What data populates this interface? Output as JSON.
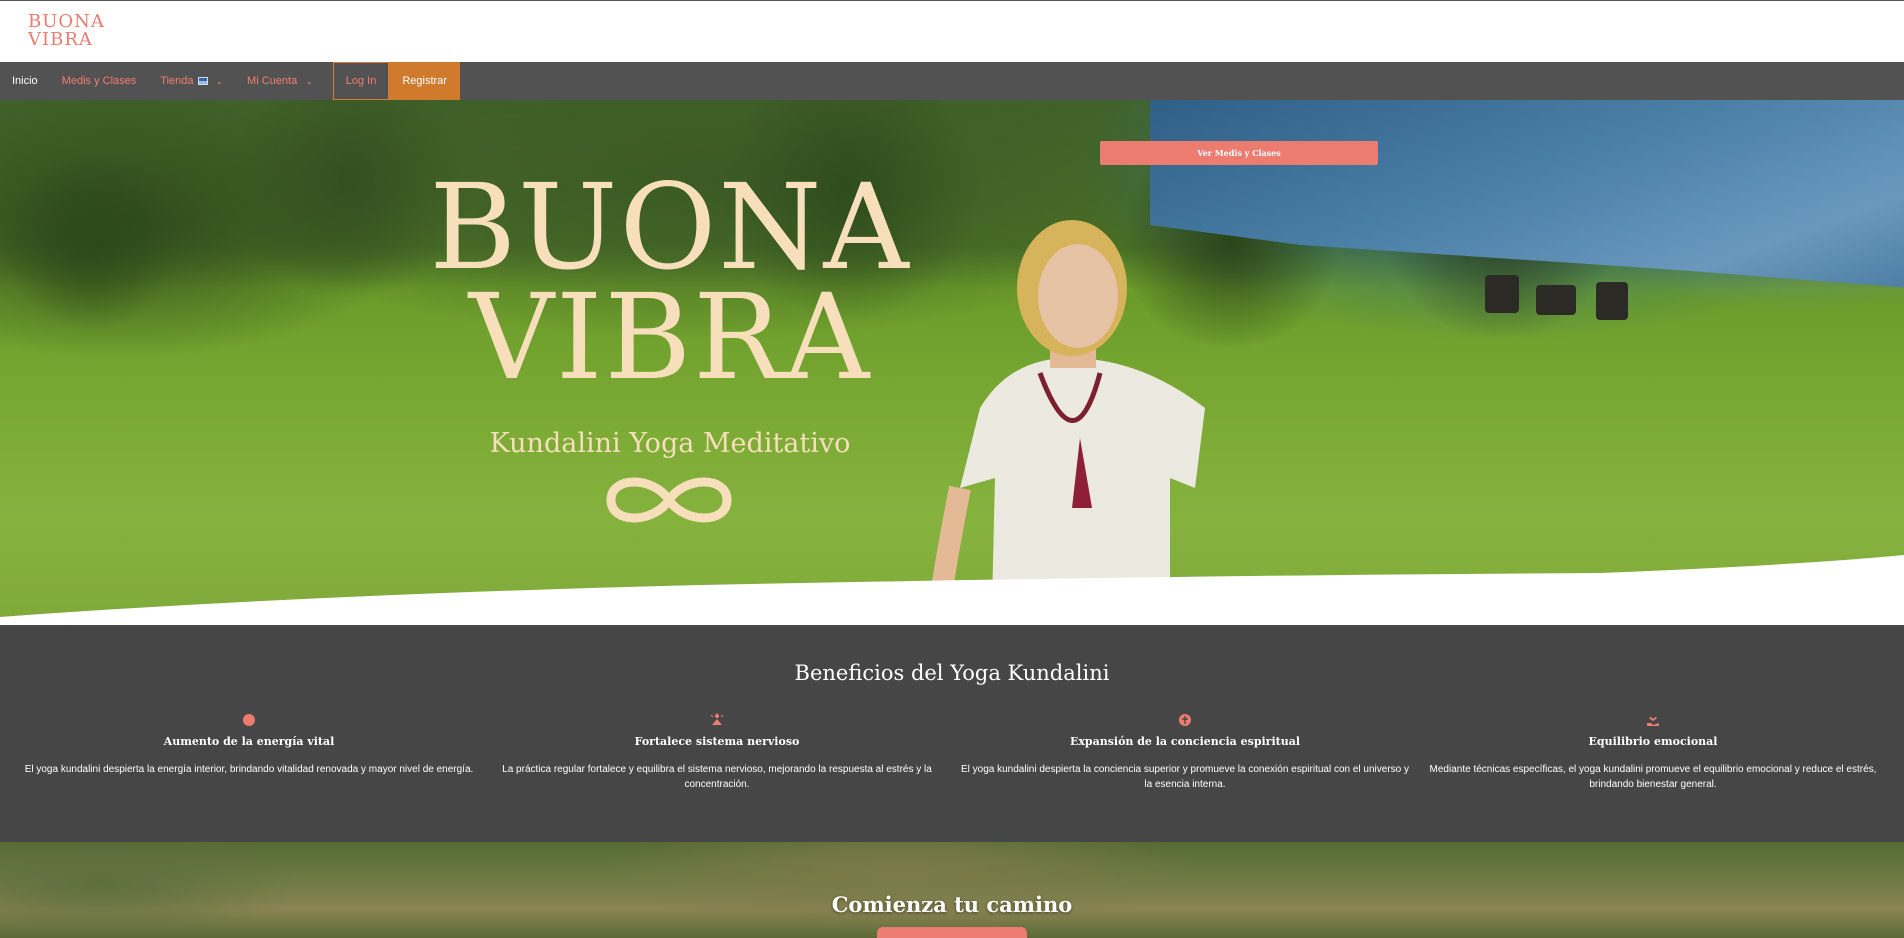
{
  "header": {
    "logo_line1": "BUONA",
    "logo_line2": "VIBRA"
  },
  "nav": {
    "items": [
      {
        "label": "Inicio"
      },
      {
        "label": "Medis y Clases"
      },
      {
        "label": "Tienda"
      },
      {
        "label": "Mi Cuenta"
      }
    ],
    "login_label": "Log In",
    "register_label": "Registrar"
  },
  "hero": {
    "title_line1": "BUONA",
    "title_line2": "VIBRA",
    "subtitle": "Kundalini Yoga Meditativo",
    "cta_label": "Ver Medis y Clases"
  },
  "benefits": {
    "title": "Beneficios del Yoga Kundalini",
    "items": [
      {
        "title": "Aumento de la energía vital",
        "text": "El yoga kundalini despierta la energía interior, brindando vitalidad renovada y mayor nivel de energía.",
        "icon": "sun-icon"
      },
      {
        "title": "Fortalece sistema nervioso",
        "text": "La práctica regular fortalece y equilibra el sistema nervioso, mejorando la respuesta al estrés y la concentración.",
        "icon": "meditation-icon"
      },
      {
        "title": "Expansión de la conciencia espiritual",
        "text": "El yoga kundalini despierta la conciencia superior y promueve la conexión espiritual con el universo y la esencia interna.",
        "icon": "spirit-icon"
      },
      {
        "title": "Equilibrio emocional",
        "text": "Mediante técnicas específicas, el yoga kundalini promueve el equilibrio emocional y reduce el estrés, brindando bienestar general.",
        "icon": "hand-heart-icon"
      }
    ]
  },
  "bottom": {
    "title": "Comienza tu camino"
  },
  "colors": {
    "accent": "#ec7b70",
    "register": "#d07a2d",
    "nav_bg": "#525252",
    "benefits_bg": "#464646",
    "hero_text": "#f7dfbc"
  }
}
